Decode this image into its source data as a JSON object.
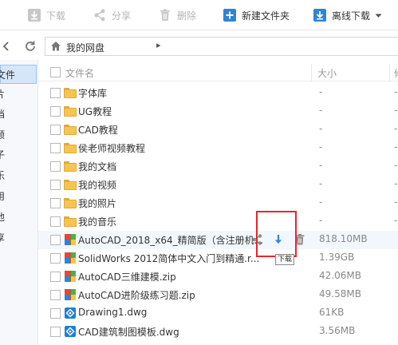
{
  "toolbar": {
    "download": "下载",
    "share": "分享",
    "delete": "删除",
    "new_folder": "新建文件夹",
    "offline_download": "离线下载"
  },
  "nav": {
    "breadcrumb": "我的网盘",
    "separator": "▸"
  },
  "sidebar": {
    "items": [
      "文件",
      "片",
      "档",
      "频",
      "子",
      "乐",
      "用",
      "他",
      "享"
    ]
  },
  "list": {
    "header": {
      "name": "文件名",
      "size": "大小",
      "extra": "修"
    },
    "rows": [
      {
        "name": "字体库",
        "size": "-",
        "type": "folder"
      },
      {
        "name": "UG教程",
        "size": "-",
        "type": "folder"
      },
      {
        "name": "CAD教程",
        "size": "-",
        "type": "folder"
      },
      {
        "name": "侯老师视频教程",
        "size": "-",
        "type": "folder"
      },
      {
        "name": "我的文档",
        "size": "-",
        "type": "folder"
      },
      {
        "name": "我的视频",
        "size": "-",
        "type": "folder"
      },
      {
        "name": "我的照片",
        "size": "-",
        "type": "folder"
      },
      {
        "name": "我的音乐",
        "size": "-",
        "type": "folder"
      },
      {
        "name": "AutoCAD_2018_x64_精简版（含注册机...",
        "size": "818.10MB",
        "type": "zip"
      },
      {
        "name": "SolidWorks 2012简体中文入门到精通.r...",
        "size": "1.39GB",
        "type": "zip"
      },
      {
        "name": "AutoCAD三维建模.zip",
        "size": "42.06MB",
        "type": "zip"
      },
      {
        "name": "AutoCAD进阶级练习题.zip",
        "size": "49.58MB",
        "type": "zip"
      },
      {
        "name": "Drawing1.dwg",
        "size": "61KB",
        "type": "dwg"
      },
      {
        "name": "CAD建筑制图模板.dwg",
        "size": "3.56MB",
        "type": "dwg"
      }
    ]
  },
  "tooltip": "下载",
  "colors": {
    "accent": "#2f84d6",
    "highlight_box": "#e8262a",
    "folder": "#f6c54f",
    "selected_sidebar": "#d5e6f8"
  }
}
